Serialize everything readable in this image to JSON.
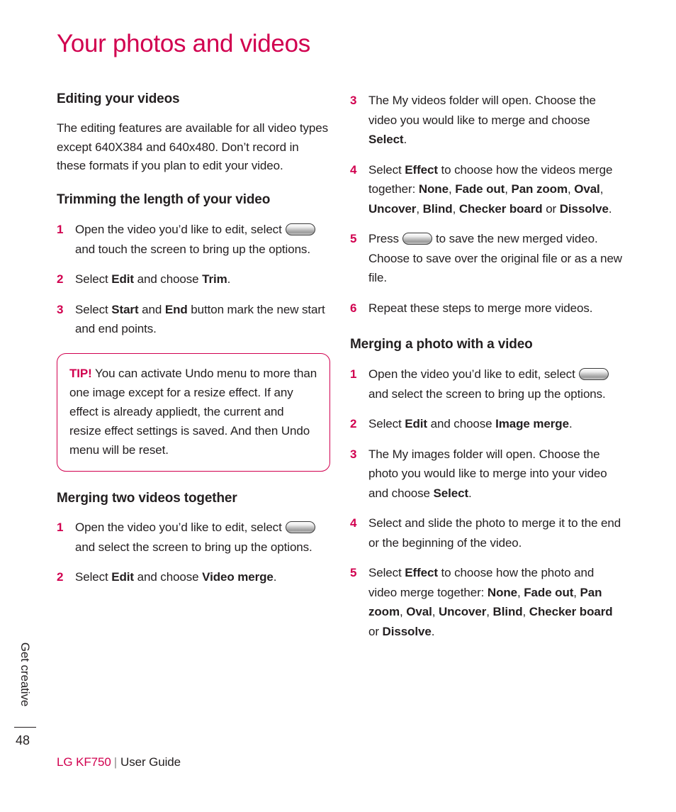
{
  "page": {
    "title": "Your photos and videos",
    "page_number": "48",
    "side_tab_label": "Get creative",
    "accent_color": "#d1004f",
    "text_color": "#231f20"
  },
  "footer": {
    "brand": "LG KF750",
    "separator": "|",
    "guide": "User Guide"
  },
  "left_column": {
    "heading_1": "Editing your videos",
    "intro": "The editing features are available for all video types except 640X384 and 640x480. Don’t record in these formats if you plan to edit your video.",
    "heading_2": "Trimming the length of your video",
    "trim_steps": [
      {
        "num": "1",
        "parts": [
          {
            "t": "Open the video you’d like to edit, select",
            "bold": false
          },
          {
            "t": "key-pill-icon",
            "icon": true
          },
          {
            "t": "and touch the screen to bring up the options.",
            "bold": false
          }
        ]
      },
      {
        "num": "2",
        "parts": [
          {
            "t": "Select ",
            "bold": false
          },
          {
            "t": "Edit",
            "bold": true
          },
          {
            "t": " and choose ",
            "bold": false
          },
          {
            "t": "Trim",
            "bold": true
          },
          {
            "t": ".",
            "bold": false
          }
        ]
      },
      {
        "num": "3",
        "parts": [
          {
            "t": "Select ",
            "bold": false
          },
          {
            "t": "Start",
            "bold": true
          },
          {
            "t": " and ",
            "bold": false
          },
          {
            "t": "End",
            "bold": true
          },
          {
            "t": " button mark the new start and end points.",
            "bold": false
          }
        ]
      }
    ],
    "tip": {
      "label": "TIP!",
      "text": " You can activate Undo menu to  more than one image except for a resize effect. If any effect is already appliedt, the current and resize effect settings is saved. And then Undo menu will be reset."
    },
    "heading_3": "Merging two videos together",
    "merge_steps": [
      {
        "num": "1",
        "parts": [
          {
            "t": "Open the video you’d like to edit, select",
            "bold": false
          },
          {
            "t": "key-pill-icon",
            "icon": true
          },
          {
            "t": "and select the screen to bring up the options.",
            "bold": false
          }
        ]
      },
      {
        "num": "2",
        "parts": [
          {
            "t": "Select ",
            "bold": false
          },
          {
            "t": "Edit",
            "bold": true
          },
          {
            "t": " and choose ",
            "bold": false
          },
          {
            "t": "Video merge",
            "bold": true
          },
          {
            "t": ".",
            "bold": false
          }
        ]
      }
    ]
  },
  "right_column": {
    "merge_steps_cont": [
      {
        "num": "3",
        "parts": [
          {
            "t": "The My videos folder will open. Choose the video you would like to merge and choose ",
            "bold": false
          },
          {
            "t": "Select",
            "bold": true
          },
          {
            "t": ".",
            "bold": false
          }
        ]
      },
      {
        "num": "4",
        "parts": [
          {
            "t": "Select ",
            "bold": false
          },
          {
            "t": "Effect",
            "bold": true
          },
          {
            "t": " to choose how the videos merge together: ",
            "bold": false
          },
          {
            "t": "None",
            "bold": true
          },
          {
            "t": ", ",
            "bold": false
          },
          {
            "t": "Fade out",
            "bold": true
          },
          {
            "t": ", ",
            "bold": false
          },
          {
            "t": "Pan zoom",
            "bold": true
          },
          {
            "t": ", ",
            "bold": false
          },
          {
            "t": "Oval",
            "bold": true
          },
          {
            "t": ", ",
            "bold": false
          },
          {
            "t": "Uncover",
            "bold": true
          },
          {
            "t": ", ",
            "bold": false
          },
          {
            "t": "Blind",
            "bold": true
          },
          {
            "t": ", ",
            "bold": false
          },
          {
            "t": "Checker board",
            "bold": true
          },
          {
            "t": " or ",
            "bold": false
          },
          {
            "t": "Dissolve",
            "bold": true
          },
          {
            "t": ".",
            "bold": false
          }
        ]
      },
      {
        "num": "5",
        "parts": [
          {
            "t": "Press",
            "bold": false
          },
          {
            "t": "key-pill-icon",
            "icon": true
          },
          {
            "t": "to save the new merged video. Choose to save over the original file or as a new file.",
            "bold": false
          }
        ]
      },
      {
        "num": "6",
        "parts": [
          {
            "t": "Repeat these steps to merge more videos.",
            "bold": false
          }
        ]
      }
    ],
    "heading_1": "Merging a photo with a video",
    "photo_steps": [
      {
        "num": "1",
        "parts": [
          {
            "t": "Open the video you’d like to edit, select",
            "bold": false
          },
          {
            "t": "key-pill-icon",
            "icon": true
          },
          {
            "t": "and select the screen to bring up the options.",
            "bold": false
          }
        ]
      },
      {
        "num": "2",
        "parts": [
          {
            "t": "Select ",
            "bold": false
          },
          {
            "t": "Edit",
            "bold": true
          },
          {
            "t": " and choose ",
            "bold": false
          },
          {
            "t": "Image merge",
            "bold": true
          },
          {
            "t": ".",
            "bold": false
          }
        ]
      },
      {
        "num": "3",
        "parts": [
          {
            "t": "The My images folder will open. Choose the photo you would like to merge into your video and choose ",
            "bold": false
          },
          {
            "t": "Select",
            "bold": true
          },
          {
            "t": ".",
            "bold": false
          }
        ]
      },
      {
        "num": "4",
        "parts": [
          {
            "t": "Select and slide the photo to merge it to the end or the beginning of the video.",
            "bold": false
          }
        ]
      },
      {
        "num": "5",
        "parts": [
          {
            "t": "Select ",
            "bold": false
          },
          {
            "t": "Effect",
            "bold": true
          },
          {
            "t": " to choose how the photo and video merge together: ",
            "bold": false
          },
          {
            "t": "None",
            "bold": true
          },
          {
            "t": ", ",
            "bold": false
          },
          {
            "t": "Fade out",
            "bold": true
          },
          {
            "t": ", ",
            "bold": false
          },
          {
            "t": "Pan zoom",
            "bold": true
          },
          {
            "t": ", ",
            "bold": false
          },
          {
            "t": "Oval",
            "bold": true
          },
          {
            "t": ", ",
            "bold": false
          },
          {
            "t": "Uncover",
            "bold": true
          },
          {
            "t": ", ",
            "bold": false
          },
          {
            "t": "Blind",
            "bold": true
          },
          {
            "t": ", ",
            "bold": false
          },
          {
            "t": "Checker board",
            "bold": true
          },
          {
            "t": " or ",
            "bold": false
          },
          {
            "t": "Dissolve",
            "bold": true
          },
          {
            "t": ".",
            "bold": false
          }
        ]
      }
    ]
  }
}
